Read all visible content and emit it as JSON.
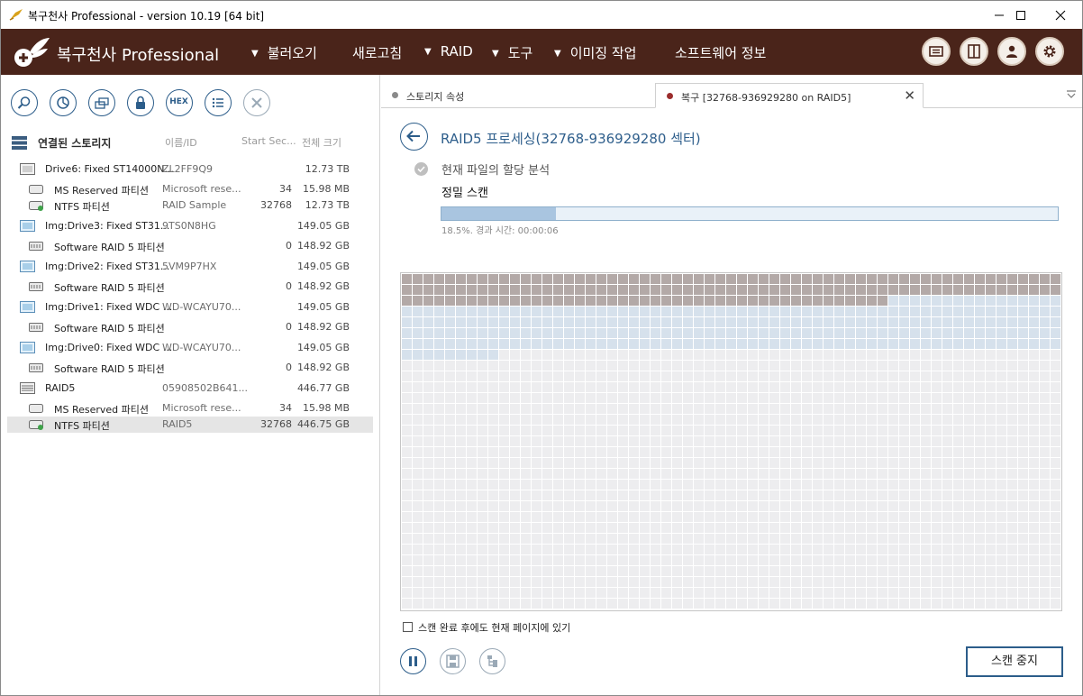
{
  "window": {
    "title": "복구천사 Professional - version 10.19 [64 bit]"
  },
  "menubar": {
    "brand": "복구천사 Professional",
    "items": [
      {
        "label": "불러오기",
        "caret": true
      },
      {
        "label": "새로고침",
        "caret": false
      },
      {
        "label": "RAID",
        "caret": true
      },
      {
        "label": "도구",
        "caret": true
      },
      {
        "label": "이미징 작업",
        "caret": true
      },
      {
        "label": "소프트웨어 정보",
        "caret": false
      }
    ],
    "caret_glyph": "▼"
  },
  "storage": {
    "header": "연결된 스토리지",
    "col_id": "이름/ID",
    "col_start": "Start Sec...",
    "col_size": "전체 크기",
    "rows": [
      {
        "name": "Drive6: Fixed ST14000N...",
        "id": "ZL2FF9Q9",
        "start": "",
        "size": "12.73 TB",
        "icon": "hdd-icon"
      },
      {
        "name": "MS Reserved 파티션",
        "id": "Microsoft rese...",
        "start": "34",
        "size": "15.98 MB",
        "icon": "partition-icon"
      },
      {
        "name": "NTFS 파티션",
        "id": "RAID Sample",
        "start": "32768",
        "size": "12.73 TB",
        "icon": "partition-ok-icon"
      },
      {
        "name": "Img:Drive3: Fixed ST31...",
        "id": "9TS0N8HG",
        "start": "",
        "size": "149.05 GB",
        "icon": "image-drive-icon"
      },
      {
        "name": "Software RAID 5 파티션",
        "id": "",
        "start": "0",
        "size": "148.92 GB",
        "icon": "raid-partition-icon"
      },
      {
        "name": "Img:Drive2: Fixed ST31...",
        "id": "5VM9P7HX",
        "start": "",
        "size": "149.05 GB",
        "icon": "image-drive-icon"
      },
      {
        "name": "Software RAID 5 파티션",
        "id": "",
        "start": "0",
        "size": "148.92 GB",
        "icon": "raid-partition-icon"
      },
      {
        "name": "Img:Drive1: Fixed WDC ...",
        "id": "WD-WCAYU70...",
        "start": "",
        "size": "149.05 GB",
        "icon": "image-drive-icon"
      },
      {
        "name": "Software RAID 5 파티션",
        "id": "",
        "start": "0",
        "size": "148.92 GB",
        "icon": "raid-partition-icon"
      },
      {
        "name": "Img:Drive0: Fixed WDC ...",
        "id": "WD-WCAYU70...",
        "start": "",
        "size": "149.05 GB",
        "icon": "image-drive-icon"
      },
      {
        "name": "Software RAID 5 파티션",
        "id": "",
        "start": "0",
        "size": "148.92 GB",
        "icon": "raid-partition-icon"
      },
      {
        "name": "RAID5",
        "id": "05908502B641...",
        "start": "",
        "size": "446.77 GB",
        "icon": "raid-array-icon"
      },
      {
        "name": "MS Reserved 파티션",
        "id": "Microsoft rese...",
        "start": "34",
        "size": "15.98 MB",
        "icon": "partition-icon"
      },
      {
        "name": "NTFS 파티션",
        "id": "RAID5",
        "start": "32768",
        "size": "446.75 GB",
        "icon": "partition-ok-icon",
        "selected": true
      }
    ]
  },
  "tabs": {
    "properties": "스토리지 속성",
    "recovery": "복구 [32768-936929280 on RAID5]",
    "close": "✕",
    "dot_inactive": "#8a8a8a",
    "dot_active": "#9b2d2d"
  },
  "scan": {
    "title": "RAID5 프로세싱(32768-936929280 섹터)",
    "step_done": "현재 파일의 할당 분석",
    "step_current": "정밀 스캔",
    "progress": 0.185,
    "status": "18.5%. 경과 시간: 00:00:06",
    "stay_label": "스캔 완료 후에도 현재 페이지에 있기",
    "stay_checked": false,
    "stop_label": "스캔 중지",
    "map": {
      "cols": 61,
      "rows": 31,
      "dark_cells": 167,
      "blue_cells": 269,
      "color_dark": "#b3a9a7",
      "color_blue": "#d6e1ec",
      "color_empty": "#ededef"
    }
  },
  "colors": {
    "menubar": "#4a241a",
    "accent": "#2c5d8a"
  }
}
